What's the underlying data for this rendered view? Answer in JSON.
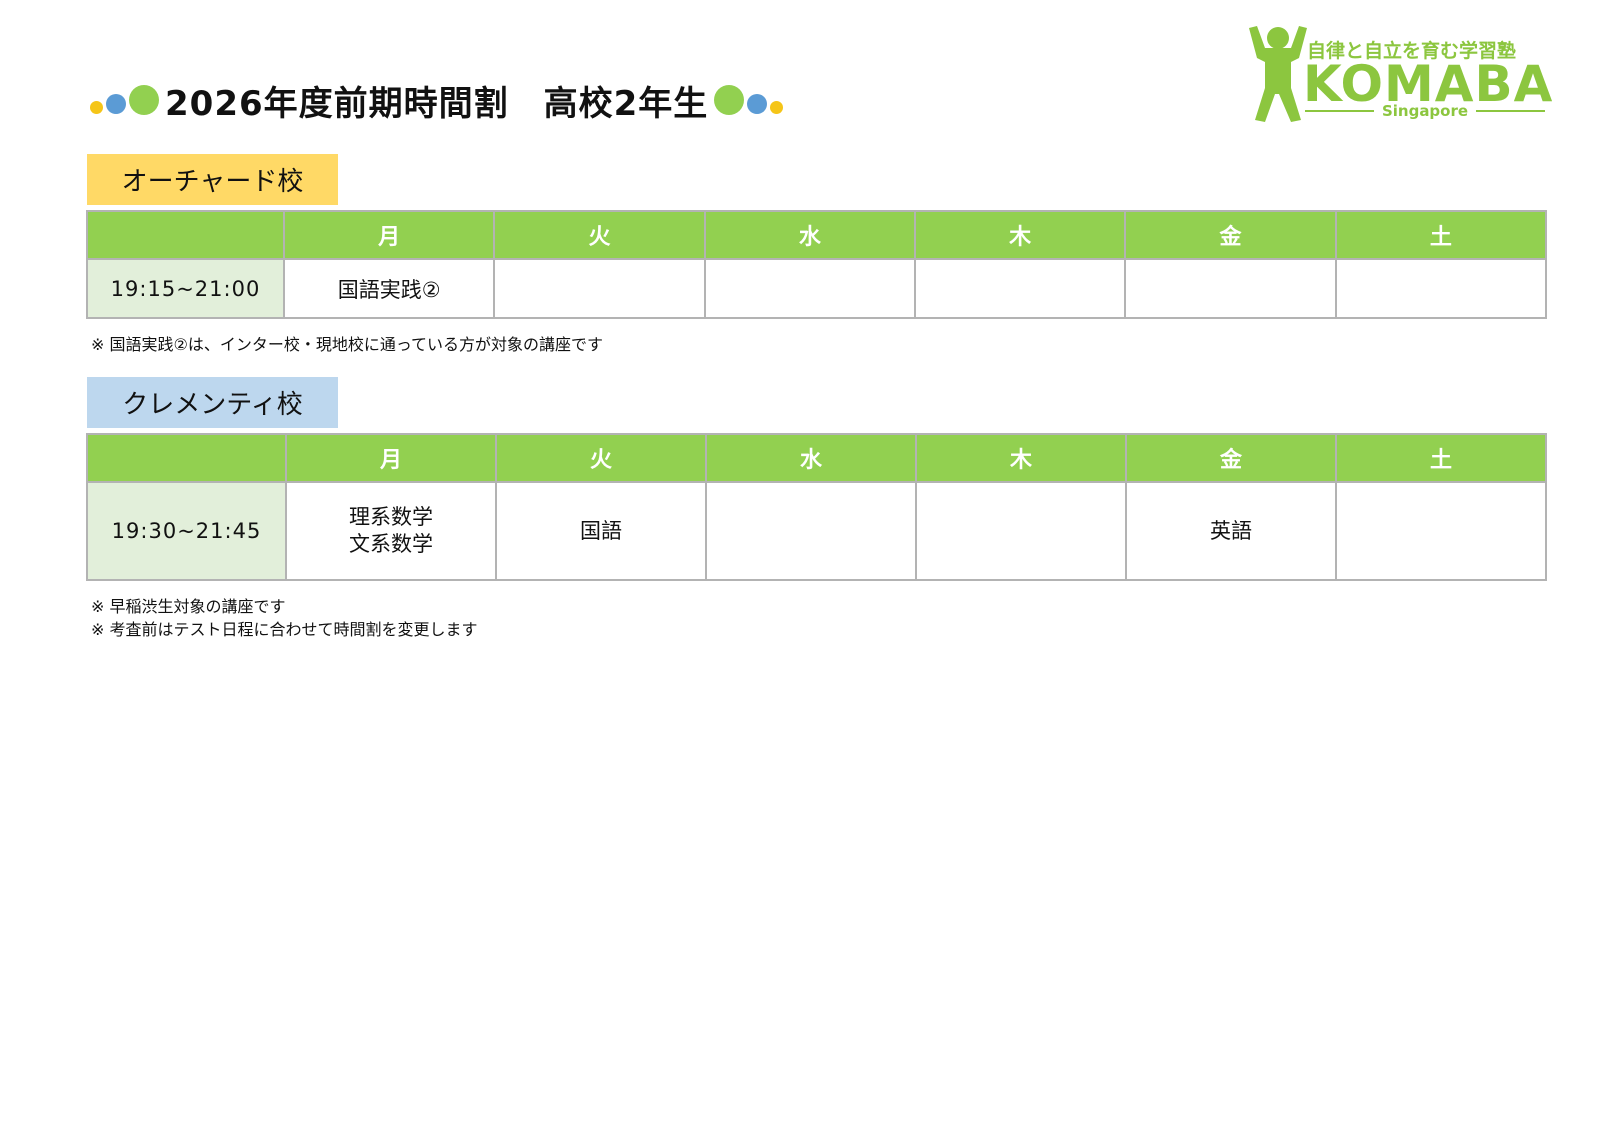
{
  "header": {
    "title": "2026年度前期時間割　高校2年生"
  },
  "logo": {
    "tagline": "自律と自立を育む学習塾",
    "word": "KOMABA",
    "sub": "Singapore"
  },
  "colors": {
    "green": "#92d050",
    "yellow": "#ffd966",
    "blue": "#bdd7ee",
    "time_bg": "#e2efda",
    "logo_green": "#8cc63f",
    "dot_yellow": "#f5c518",
    "dot_blue": "#5b9bd5"
  },
  "days": [
    "月",
    "火",
    "水",
    "木",
    "金",
    "土"
  ],
  "orchard": {
    "label": "オーチャード校",
    "time": "19:15~21:00",
    "cells": [
      "国語実践②",
      "",
      "",
      "",
      "",
      ""
    ],
    "note": "※  国語実践②は、インター校・現地校に通っている方が対象の講座です"
  },
  "clementi": {
    "label": "クレメンティ校",
    "time": "19:30~21:45",
    "cells": [
      [
        "理系数学",
        "文系数学"
      ],
      [
        "国語"
      ],
      [
        ""
      ],
      [
        ""
      ],
      [
        "英語"
      ],
      [
        ""
      ]
    ],
    "notes": [
      "※  早稲渋生対象の講座です",
      "※  考査前はテスト日程に合わせて時間割を変更します"
    ]
  }
}
